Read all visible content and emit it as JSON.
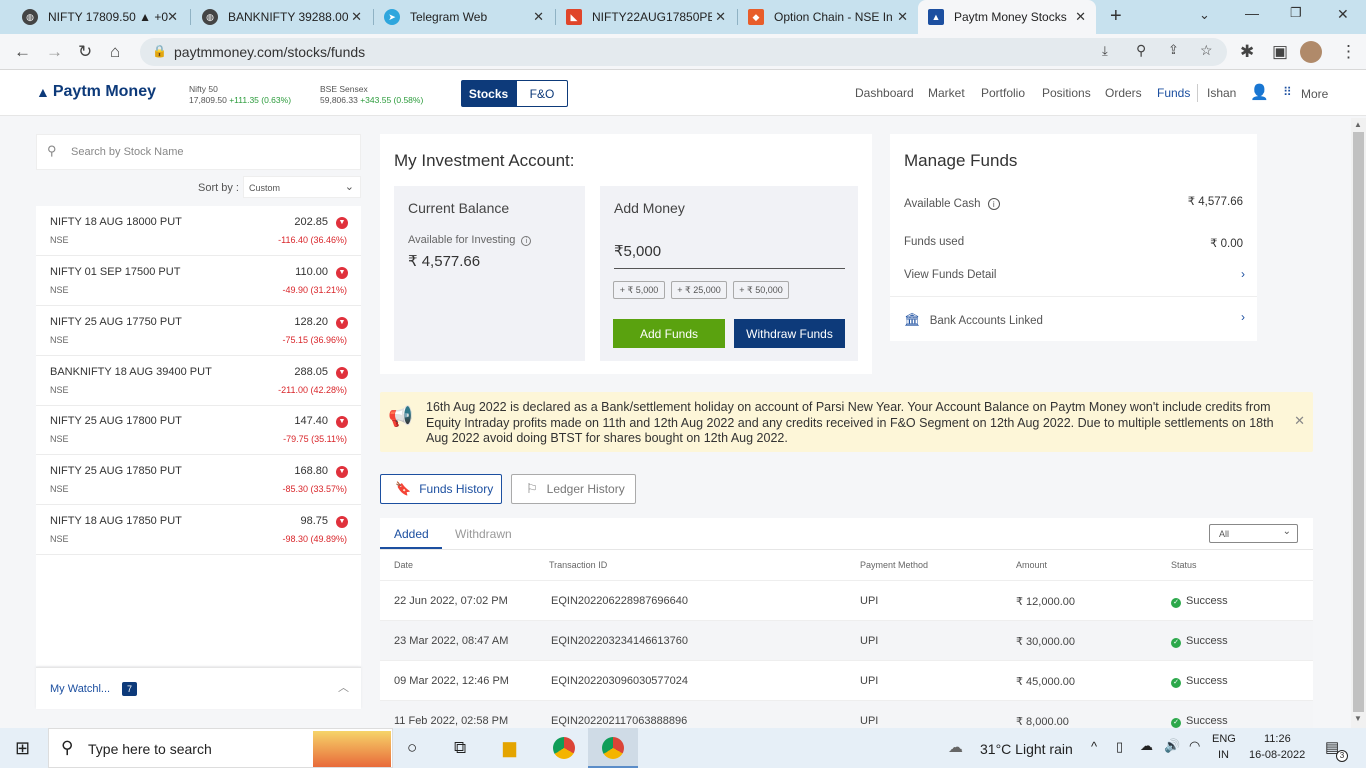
{
  "browser": {
    "tabs": [
      {
        "title": "NIFTY 17809.50 ▲ +0.",
        "fav": "globe-icon"
      },
      {
        "title": "BANKNIFTY 39288.00",
        "fav": "globe-icon"
      },
      {
        "title": "Telegram Web",
        "fav": "telegram-icon"
      },
      {
        "title": "NIFTY22AUG17850PE",
        "fav": "chart-icon"
      },
      {
        "title": "Option Chain - NSE In",
        "fav": "nse-icon"
      },
      {
        "title": "Paytm Money Stocks",
        "fav": "paytm-icon"
      }
    ],
    "url": "paytmmoney.com/stocks/funds"
  },
  "header": {
    "logo": "Paytm Money",
    "nifty_label": "Nifty 50",
    "nifty_value": "17,809.50",
    "nifty_change": "+111.35 (0.63%)",
    "sensex_label": "BSE Sensex",
    "sensex_value": "59,806.33",
    "sensex_change": "+343.55 (0.58%)",
    "toggle": [
      "Stocks",
      "F&O"
    ],
    "nav": [
      "Dashboard",
      "Market",
      "Portfolio",
      "Positions",
      "Orders",
      "Funds"
    ],
    "user": "Ishan",
    "more": "More"
  },
  "sidebar": {
    "search_placeholder": "Search by Stock Name",
    "sort_label": "Sort by :",
    "sort_value": "Custom",
    "items": [
      {
        "name": "NIFTY 18 AUG 18000 PUT",
        "exch": "NSE",
        "price": "202.85",
        "change": "-116.40 (36.46%)"
      },
      {
        "name": "NIFTY 01 SEP 17500 PUT",
        "exch": "NSE",
        "price": "110.00",
        "change": "-49.90 (31.21%)"
      },
      {
        "name": "NIFTY 25 AUG 17750 PUT",
        "exch": "NSE",
        "price": "128.20",
        "change": "-75.15 (36.96%)"
      },
      {
        "name": "BANKNIFTY 18 AUG 39400 PUT",
        "exch": "NSE",
        "price": "288.05",
        "change": "-211.00 (42.28%)"
      },
      {
        "name": "NIFTY 25 AUG 17800 PUT",
        "exch": "NSE",
        "price": "147.40",
        "change": "-79.75 (35.11%)"
      },
      {
        "name": "NIFTY 25 AUG 17850 PUT",
        "exch": "NSE",
        "price": "168.80",
        "change": "-85.30 (33.57%)"
      },
      {
        "name": "NIFTY 18 AUG 17850 PUT",
        "exch": "NSE",
        "price": "98.75",
        "change": "-98.30 (49.89%)"
      }
    ],
    "watchlist_label": "My Watchl...",
    "watchlist_count": "7"
  },
  "invest": {
    "title": "My Investment Account:",
    "current_balance_label": "Current Balance",
    "available_label": "Available for Investing",
    "available_value": "₹ 4,577.66",
    "add_money_label": "Add Money",
    "amount": "₹5,000",
    "chips": [
      "+ ₹ 5,000",
      "+ ₹ 25,000",
      "+ ₹ 50,000"
    ],
    "add_funds": "Add Funds",
    "withdraw_funds": "Withdraw Funds"
  },
  "manage": {
    "title": "Manage Funds",
    "available_cash_label": "Available Cash",
    "available_cash_value": "₹ 4,577.66",
    "funds_used_label": "Funds used",
    "funds_used_value": "₹ 0.00",
    "view_detail": "View Funds Detail",
    "bank_linked": "Bank Accounts Linked"
  },
  "notice": {
    "text": "16th Aug 2022 is declared as a Bank/settlement holiday on account of Parsi New Year. Your Account Balance on Paytm Money won't include credits from Equity Intraday profits made on 11th and 12th Aug 2022 and any credits received in F&O Segment on 12th Aug 2022. Due to multiple settlements on 18th Aug 2022 avoid doing BTST for shares bought on 12th Aug 2022."
  },
  "history": {
    "funds_history": "Funds History",
    "ledger_history": "Ledger History",
    "tabs": [
      "Added",
      "Withdrawn"
    ],
    "filter": "All",
    "columns": [
      "Date",
      "Transaction ID",
      "Payment Method",
      "Amount",
      "Status"
    ],
    "rows": [
      {
        "date": "22 Jun 2022, 07:02 PM",
        "txn": "EQIN202206228987696640",
        "method": "UPI",
        "amount": "₹ 12,000.00",
        "status": "Success"
      },
      {
        "date": "23 Mar 2022, 08:47 AM",
        "txn": "EQIN202203234146613760",
        "method": "UPI",
        "amount": "₹ 30,000.00",
        "status": "Success"
      },
      {
        "date": "09 Mar 2022, 12:46 PM",
        "txn": "EQIN202203096030577024",
        "method": "UPI",
        "amount": "₹ 45,000.00",
        "status": "Success"
      },
      {
        "date": "11 Feb 2022, 02:58 PM",
        "txn": "EQIN202202117063888896",
        "method": "UPI",
        "amount": "₹ 8,000.00",
        "status": "Success"
      }
    ]
  },
  "taskbar": {
    "search_placeholder": "Type here to search",
    "weather": "31°C  Light rain",
    "lang": "ENG",
    "region": "IN",
    "time": "11:26",
    "date": "16-08-2022",
    "notif_count": "3"
  },
  "colors": {
    "brand_navy": "#0d3a7a",
    "green": "#5aa20f",
    "accent_blue": "#1c4fa0"
  }
}
